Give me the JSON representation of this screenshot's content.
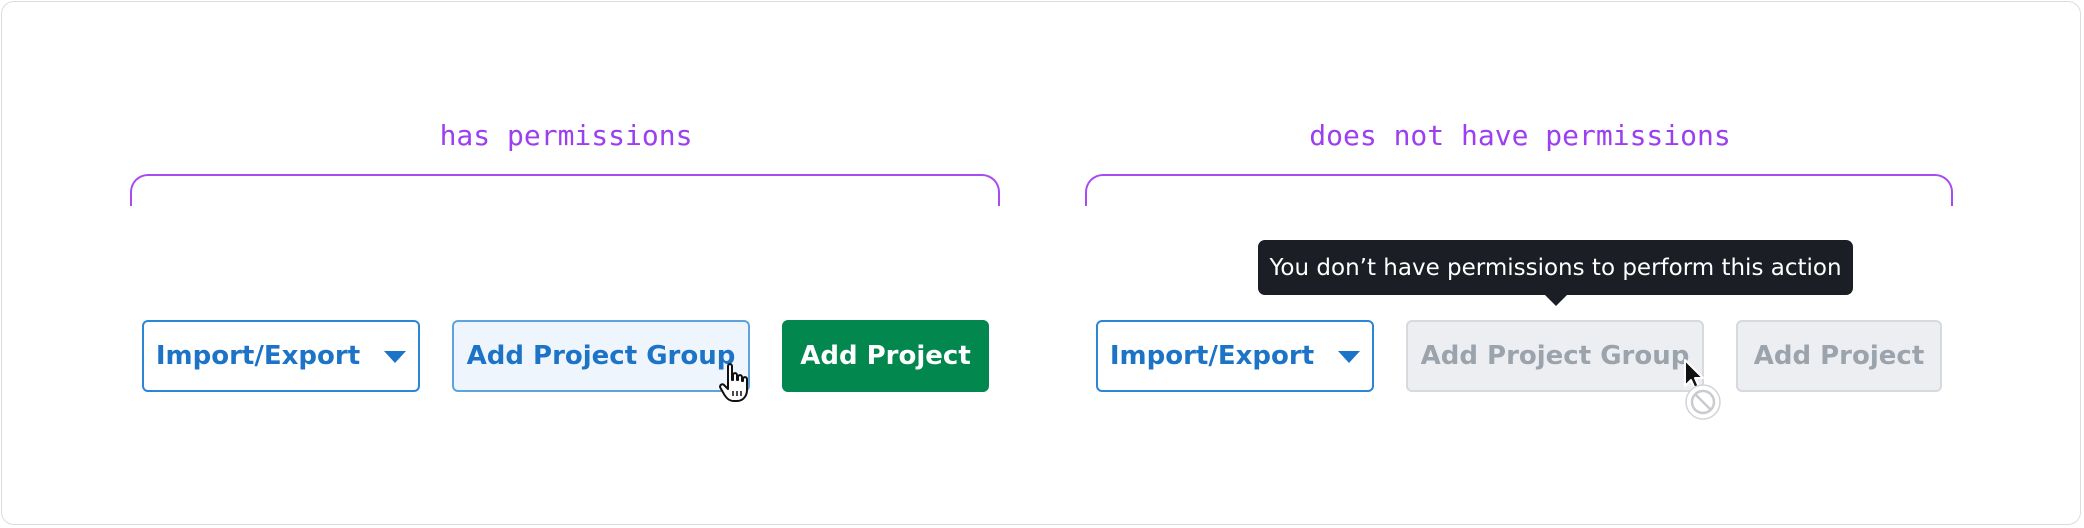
{
  "left_group": {
    "label": "has permissions",
    "import_export_label": "Import/Export",
    "add_group_label": "Add Project Group",
    "add_project_label": "Add Project"
  },
  "right_group": {
    "label": "does not have permissions",
    "import_export_label": "Import/Export",
    "add_group_label": "Add Project Group",
    "add_project_label": "Add Project",
    "tooltip": "You don’t have permissions to perform this action"
  },
  "colors": {
    "annotation": "#9b3ff0",
    "link_blue": "#1d74c6",
    "primary_green": "#02874e",
    "tooltip_bg": "#1b1e24",
    "disabled_text": "#9ba3ad"
  },
  "icons": {
    "dropdown": "caret-down-icon",
    "hover_cursor": "pointer-hand-icon",
    "disabled_cursor": "not-allowed-cursor-icon"
  }
}
